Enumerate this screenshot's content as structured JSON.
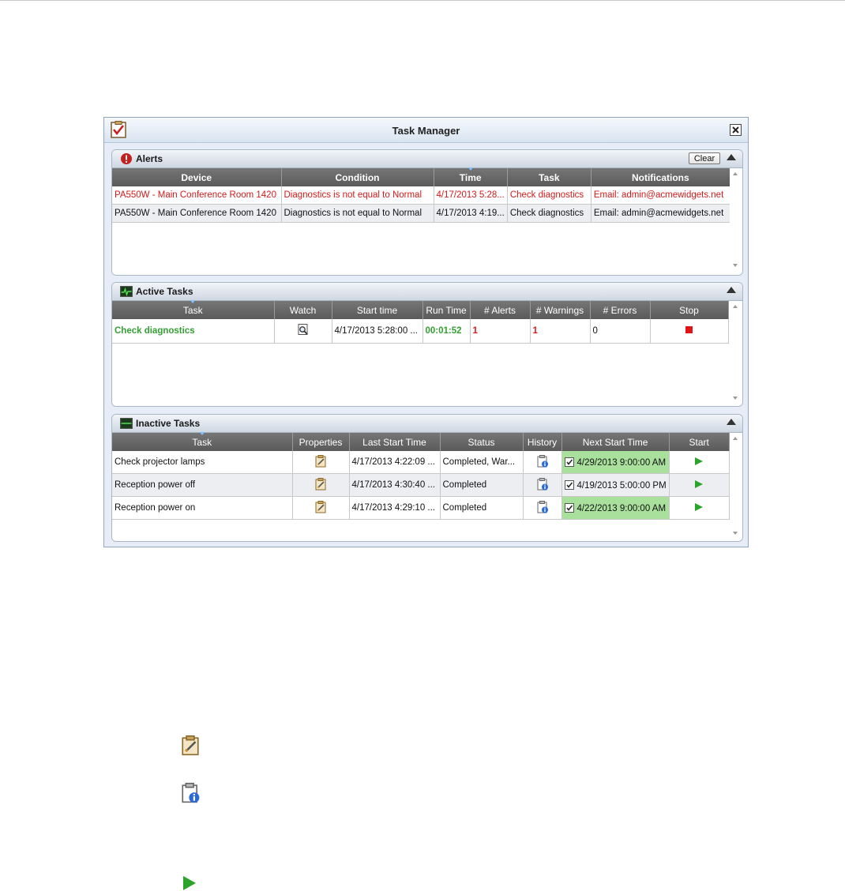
{
  "window": {
    "title": "Task Manager"
  },
  "alerts": {
    "title": "Alerts",
    "clear_label": "Clear",
    "columns": [
      "Device",
      "Condition",
      "Time",
      "Task",
      "Notifications"
    ],
    "rows": [
      [
        "PA550W - Main Conference Room 1420",
        "Diagnostics  is not equal to Normal",
        "4/17/2013 5:28...",
        "Check diagnostics",
        "Email: admin@acmewidgets.net"
      ],
      [
        "PA550W - Main Conference Room 1420",
        "Diagnostics  is not equal to Normal",
        "4/17/2013 4:19...",
        "Check diagnostics",
        "Email: admin@acmewidgets.net"
      ]
    ]
  },
  "active": {
    "title": "Active Tasks",
    "columns": [
      "Task",
      "Watch",
      "Start time",
      "Run Time",
      "# Alerts",
      "# Warnings",
      "# Errors",
      "Stop"
    ],
    "rows": [
      {
        "task": "Check diagnostics",
        "start": "4/17/2013 5:28:00 ...",
        "runtime": "00:01:52",
        "alerts": "1",
        "warnings": "1",
        "errors": "0"
      }
    ]
  },
  "inactive": {
    "title": "Inactive Tasks",
    "columns": [
      "Task",
      "Properties",
      "Last Start Time",
      "Status",
      "History",
      "Next Start Time",
      "Start"
    ],
    "rows": [
      {
        "task": "Check projector lamps",
        "last": "4/17/2013 4:22:09 ...",
        "status": "Completed, War...",
        "next": "4/29/2013 9:00:00 AM"
      },
      {
        "task": "Reception power off",
        "last": "4/17/2013 4:30:40 ...",
        "status": "Completed",
        "next": "4/19/2013 5:00:00 PM"
      },
      {
        "task": "Reception power on",
        "last": "4/17/2013 4:29:10 ...",
        "status": "Completed",
        "next": "4/22/2013 9:00:00 AM"
      }
    ]
  },
  "icons": {
    "properties": "clipboard-edit-icon",
    "history": "clipboard-info-icon",
    "start": "play-icon",
    "stop": "stop-icon",
    "watch": "magnifier-icon"
  },
  "colors": {
    "alert_red": "#d21a1a",
    "running_green": "#33a033",
    "next_start_bg": "#a8e09c",
    "play_green": "#2aa42a"
  }
}
